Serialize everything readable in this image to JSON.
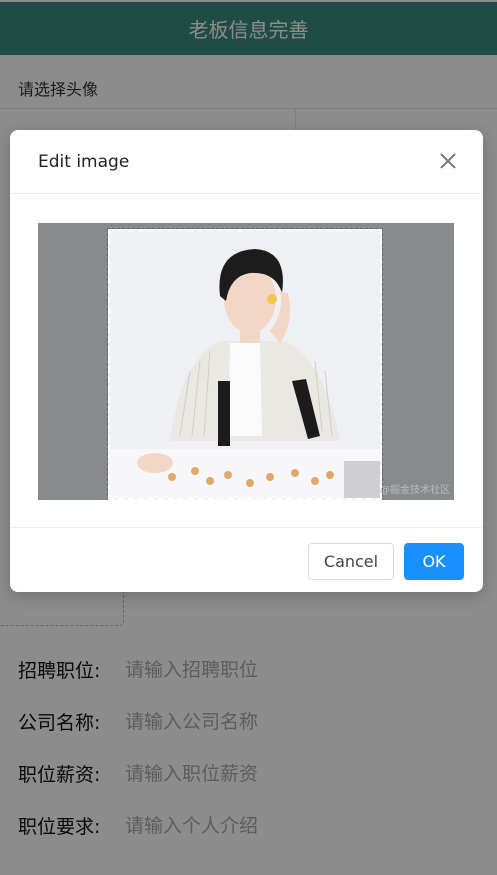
{
  "header": {
    "title": "老板信息完善"
  },
  "avatar": {
    "label": "请选择头像"
  },
  "fields": [
    {
      "label": "招聘职位:",
      "placeholder": "请输入招聘职位"
    },
    {
      "label": "公司名称:",
      "placeholder": "请输入公司名称"
    },
    {
      "label": "职位薪资:",
      "placeholder": "请输入职位薪资"
    },
    {
      "label": "职位要求:",
      "placeholder": "请输入个人介绍"
    }
  ],
  "modal": {
    "title": "Edit image",
    "cancel_label": "Cancel",
    "ok_label": "OK",
    "close_icon": "close-icon",
    "watermark": "@掘金技术社区"
  },
  "colors": {
    "header_bg": "#3b8a80",
    "primary": "#1890ff"
  }
}
